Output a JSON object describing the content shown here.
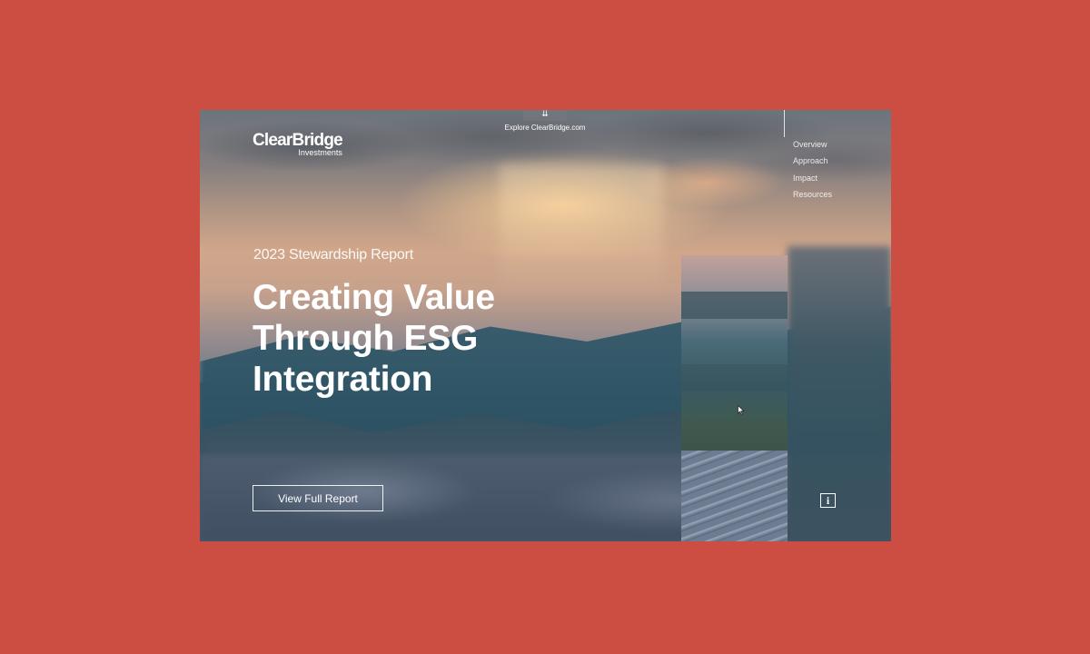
{
  "header": {
    "explore_icon": "chevron-double-down-icon",
    "explore_label": "Explore ClearBridge.com",
    "logo_main": "ClearBridge",
    "logo_sub": "Investments"
  },
  "nav": {
    "items": [
      {
        "label": "Overview"
      },
      {
        "label": "Approach"
      },
      {
        "label": "Impact"
      },
      {
        "label": "Resources"
      }
    ]
  },
  "hero": {
    "eyebrow": "2023 Stewardship Report",
    "headline": "Creating Value\nThrough ESG\nIntegration",
    "cta_label": "View Full Report"
  },
  "info": {
    "label": "i",
    "icon": "info-icon"
  },
  "colors": {
    "page_background": "#cc4e42",
    "text": "#ffffff"
  }
}
